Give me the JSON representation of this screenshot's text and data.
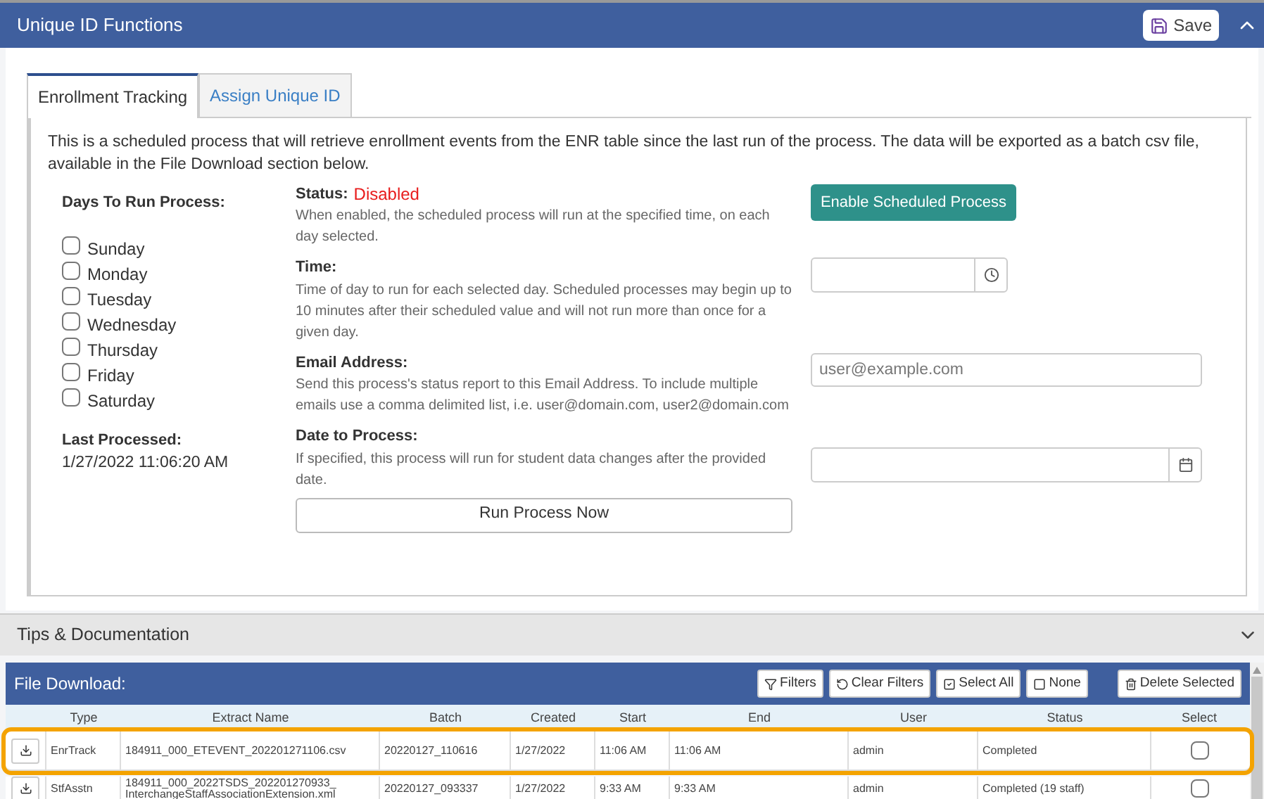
{
  "header": {
    "title": "Unique ID Functions",
    "save_label": "Save"
  },
  "tabs": [
    {
      "label": "Enrollment Tracking",
      "selected": true
    },
    {
      "label": "Assign Unique ID",
      "selected": false
    }
  ],
  "intro": "This is a scheduled process that will retrieve enrollment events from the ENR table since the last run of the process. The data will be exported as a batch csv file, available in the File Download section below.",
  "days": {
    "title": "Days To Run Process:",
    "items": [
      {
        "label": "Sunday",
        "checked": false
      },
      {
        "label": "Monday",
        "checked": false
      },
      {
        "label": "Tuesday",
        "checked": false
      },
      {
        "label": "Wednesday",
        "checked": false
      },
      {
        "label": "Thursday",
        "checked": false
      },
      {
        "label": "Friday",
        "checked": false
      },
      {
        "label": "Saturday",
        "checked": false
      }
    ]
  },
  "last_processed": {
    "label": "Last Processed:",
    "value": "1/27/2022 11:06:20 AM"
  },
  "status": {
    "label": "Status:",
    "value": "Disabled",
    "enabled": false,
    "help": "When enabled, the scheduled process will run at the specified time, on each day selected.",
    "button": "Enable Scheduled Process"
  },
  "time": {
    "label": "Time:",
    "help": "Time of day to run for each selected day. Scheduled processes may begin up to 10 minutes after their scheduled value and will not run more than once for a given day."
  },
  "email": {
    "label": "Email Address:",
    "help": "Send this process's status report to this Email Address. To include multiple emails use a comma delimited list, i.e. user@domain.com, user2@domain.com",
    "placeholder": "user@example.com"
  },
  "date": {
    "label": "Date to Process:",
    "help": "If specified, this process will run for student data changes after the provided date."
  },
  "run_button": "Run Process Now",
  "tips": {
    "title": "Tips & Documentation",
    "expanded": false
  },
  "file_download": {
    "title": "File Download:",
    "buttons": [
      "Filters",
      "Clear Filters",
      "Select All",
      "None",
      "Delete Selected"
    ],
    "columns": [
      "Type",
      "Extract Name",
      "Batch",
      "Created",
      "Start",
      "End",
      "User",
      "Status",
      "Select"
    ],
    "rows": [
      {
        "highlighted": true,
        "checked": false,
        "cells": [
          "EnrTrack",
          "184911_000_ETEVENT_202201271106.csv",
          "20220127_110616",
          "1/27/2022",
          "11:06 AM",
          "11:06 AM",
          "admin",
          "Completed"
        ]
      },
      {
        "highlighted": false,
        "checked": false,
        "cells": [
          "StfAsstn",
          "184911_000_2022TSDS_202201270933_ InterchangeStaffAssociationExtension.xml",
          "20220127_093337",
          "1/27/2022",
          "9:33 AM",
          "9:33 AM",
          "admin",
          "Completed (19 staff)"
        ]
      }
    ]
  }
}
